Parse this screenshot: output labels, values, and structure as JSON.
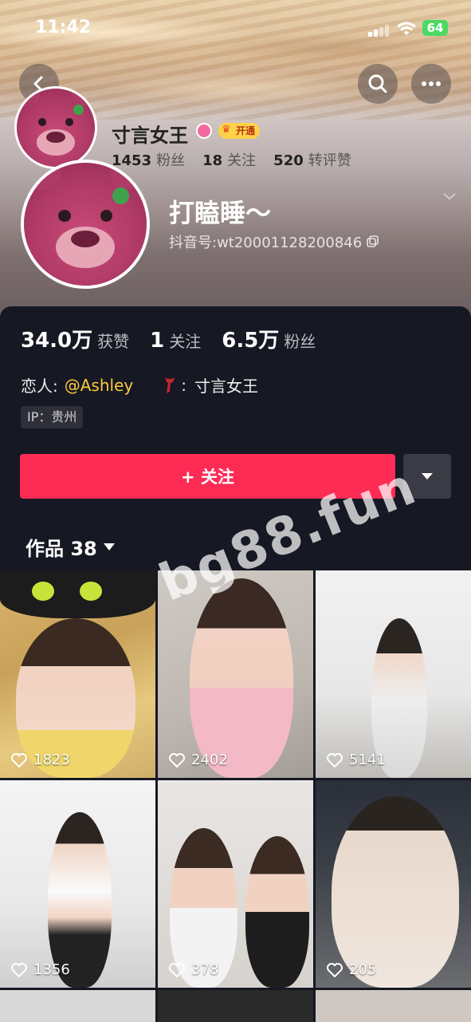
{
  "status": {
    "time": "11:42",
    "battery": "64"
  },
  "mini_header": {
    "name": "寸言女王",
    "badge": "开通",
    "stats": [
      {
        "value": "1453",
        "label": "粉丝"
      },
      {
        "value": "18",
        "label": "关注"
      },
      {
        "value": "520",
        "label": "转评赞"
      }
    ]
  },
  "profile": {
    "nickname": "打瞌睡～",
    "douyin_id": "抖音号:wt20001128200846"
  },
  "stats": [
    {
      "value": "34.0万",
      "label": "获赞"
    },
    {
      "value": "1",
      "label": "关注"
    },
    {
      "value": "6.5万",
      "label": "粉丝"
    }
  ],
  "info": {
    "relation_label": "恋人:",
    "relation_mention": "@Ashley",
    "scarf_label": ":",
    "scarf_value": "寸言女王",
    "ip": "IP：贵州"
  },
  "actions": {
    "follow_label": "+ 关注"
  },
  "works": {
    "tab_label": "作品 38"
  },
  "watermark": "bg88.fun",
  "videos": [
    {
      "likes": "1823"
    },
    {
      "likes": "2402"
    },
    {
      "likes": "5141"
    },
    {
      "likes": "1356"
    },
    {
      "likes": "378"
    },
    {
      "likes": "205"
    }
  ],
  "colors": {
    "accent": "#fe2c55",
    "mention": "#ffc83a",
    "background": "#161823"
  }
}
